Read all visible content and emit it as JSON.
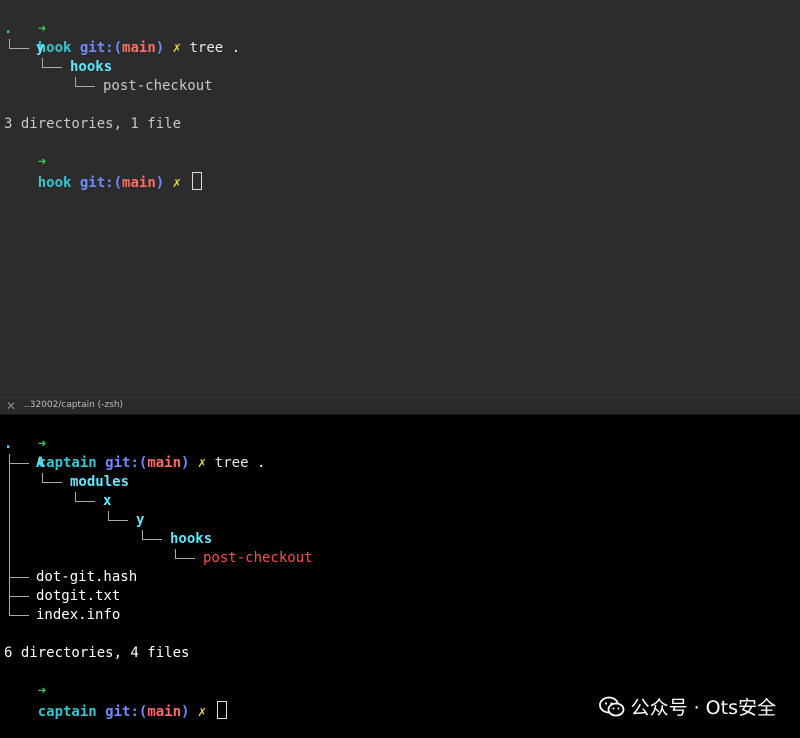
{
  "top_pane": {
    "prompt": {
      "arrow": "➜",
      "dir": "hook",
      "git": "git:(",
      "branch": "main",
      "git_close": ")",
      "dirty": "✗",
      "command": "tree ."
    },
    "tree": {
      "root": ".",
      "items": [
        "y",
        "hooks",
        "post-checkout"
      ]
    },
    "summary": "3 directories, 1 file",
    "prompt2": {
      "arrow": "➜",
      "dir": "hook",
      "git": "git:(",
      "branch": "main",
      "git_close": ")",
      "dirty": "✗"
    }
  },
  "divider": {
    "close_icon": "✕",
    "title": "..32002/captain (-zsh)"
  },
  "bottom_pane": {
    "prompt": {
      "arrow": "➜",
      "dir": "captain",
      "git": "git:(",
      "branch": "main",
      "git_close": ")",
      "dirty": "✗",
      "command": "tree ."
    },
    "tree": {
      "root": ".",
      "items": [
        "A",
        "modules",
        "x",
        "y",
        "hooks",
        "post-checkout",
        "dot-git.hash",
        "dotgit.txt",
        "index.info"
      ]
    },
    "summary": "6 directories, 4 files",
    "prompt2": {
      "arrow": "➜",
      "dir": "captain",
      "git": "git:(",
      "branch": "main",
      "git_close": ")",
      "dirty": "✗"
    }
  },
  "watermark": {
    "text": "公众号 · Ots安全",
    "icon": "wechat-icon"
  }
}
